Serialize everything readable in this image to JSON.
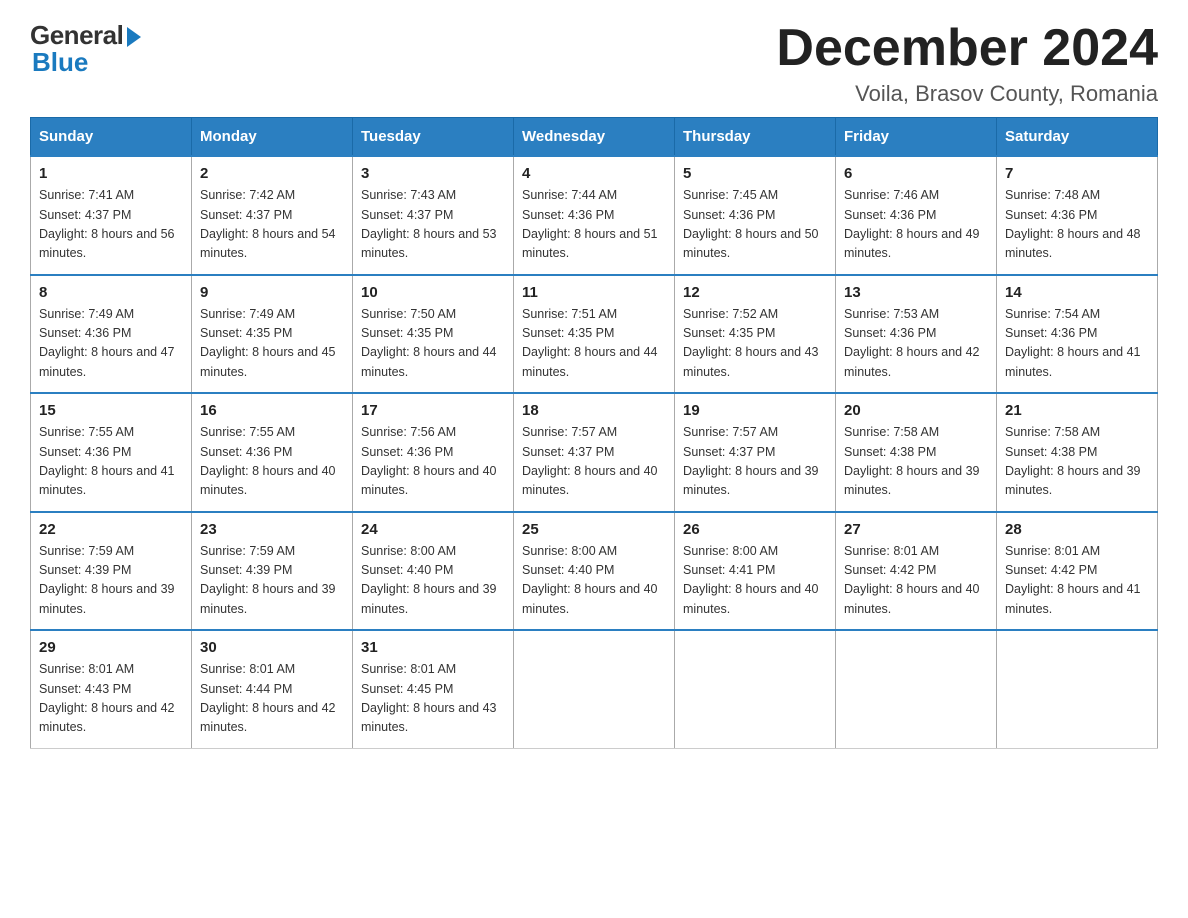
{
  "logo": {
    "general": "General",
    "blue": "Blue"
  },
  "title": "December 2024",
  "location": "Voila, Brasov County, Romania",
  "weekdays": [
    "Sunday",
    "Monday",
    "Tuesday",
    "Wednesday",
    "Thursday",
    "Friday",
    "Saturday"
  ],
  "weeks": [
    [
      {
        "day": "1",
        "sunrise": "7:41 AM",
        "sunset": "4:37 PM",
        "daylight": "8 hours and 56 minutes."
      },
      {
        "day": "2",
        "sunrise": "7:42 AM",
        "sunset": "4:37 PM",
        "daylight": "8 hours and 54 minutes."
      },
      {
        "day": "3",
        "sunrise": "7:43 AM",
        "sunset": "4:37 PM",
        "daylight": "8 hours and 53 minutes."
      },
      {
        "day": "4",
        "sunrise": "7:44 AM",
        "sunset": "4:36 PM",
        "daylight": "8 hours and 51 minutes."
      },
      {
        "day": "5",
        "sunrise": "7:45 AM",
        "sunset": "4:36 PM",
        "daylight": "8 hours and 50 minutes."
      },
      {
        "day": "6",
        "sunrise": "7:46 AM",
        "sunset": "4:36 PM",
        "daylight": "8 hours and 49 minutes."
      },
      {
        "day": "7",
        "sunrise": "7:48 AM",
        "sunset": "4:36 PM",
        "daylight": "8 hours and 48 minutes."
      }
    ],
    [
      {
        "day": "8",
        "sunrise": "7:49 AM",
        "sunset": "4:36 PM",
        "daylight": "8 hours and 47 minutes."
      },
      {
        "day": "9",
        "sunrise": "7:49 AM",
        "sunset": "4:35 PM",
        "daylight": "8 hours and 45 minutes."
      },
      {
        "day": "10",
        "sunrise": "7:50 AM",
        "sunset": "4:35 PM",
        "daylight": "8 hours and 44 minutes."
      },
      {
        "day": "11",
        "sunrise": "7:51 AM",
        "sunset": "4:35 PM",
        "daylight": "8 hours and 44 minutes."
      },
      {
        "day": "12",
        "sunrise": "7:52 AM",
        "sunset": "4:35 PM",
        "daylight": "8 hours and 43 minutes."
      },
      {
        "day": "13",
        "sunrise": "7:53 AM",
        "sunset": "4:36 PM",
        "daylight": "8 hours and 42 minutes."
      },
      {
        "day": "14",
        "sunrise": "7:54 AM",
        "sunset": "4:36 PM",
        "daylight": "8 hours and 41 minutes."
      }
    ],
    [
      {
        "day": "15",
        "sunrise": "7:55 AM",
        "sunset": "4:36 PM",
        "daylight": "8 hours and 41 minutes."
      },
      {
        "day": "16",
        "sunrise": "7:55 AM",
        "sunset": "4:36 PM",
        "daylight": "8 hours and 40 minutes."
      },
      {
        "day": "17",
        "sunrise": "7:56 AM",
        "sunset": "4:36 PM",
        "daylight": "8 hours and 40 minutes."
      },
      {
        "day": "18",
        "sunrise": "7:57 AM",
        "sunset": "4:37 PM",
        "daylight": "8 hours and 40 minutes."
      },
      {
        "day": "19",
        "sunrise": "7:57 AM",
        "sunset": "4:37 PM",
        "daylight": "8 hours and 39 minutes."
      },
      {
        "day": "20",
        "sunrise": "7:58 AM",
        "sunset": "4:38 PM",
        "daylight": "8 hours and 39 minutes."
      },
      {
        "day": "21",
        "sunrise": "7:58 AM",
        "sunset": "4:38 PM",
        "daylight": "8 hours and 39 minutes."
      }
    ],
    [
      {
        "day": "22",
        "sunrise": "7:59 AM",
        "sunset": "4:39 PM",
        "daylight": "8 hours and 39 minutes."
      },
      {
        "day": "23",
        "sunrise": "7:59 AM",
        "sunset": "4:39 PM",
        "daylight": "8 hours and 39 minutes."
      },
      {
        "day": "24",
        "sunrise": "8:00 AM",
        "sunset": "4:40 PM",
        "daylight": "8 hours and 39 minutes."
      },
      {
        "day": "25",
        "sunrise": "8:00 AM",
        "sunset": "4:40 PM",
        "daylight": "8 hours and 40 minutes."
      },
      {
        "day": "26",
        "sunrise": "8:00 AM",
        "sunset": "4:41 PM",
        "daylight": "8 hours and 40 minutes."
      },
      {
        "day": "27",
        "sunrise": "8:01 AM",
        "sunset": "4:42 PM",
        "daylight": "8 hours and 40 minutes."
      },
      {
        "day": "28",
        "sunrise": "8:01 AM",
        "sunset": "4:42 PM",
        "daylight": "8 hours and 41 minutes."
      }
    ],
    [
      {
        "day": "29",
        "sunrise": "8:01 AM",
        "sunset": "4:43 PM",
        "daylight": "8 hours and 42 minutes."
      },
      {
        "day": "30",
        "sunrise": "8:01 AM",
        "sunset": "4:44 PM",
        "daylight": "8 hours and 42 minutes."
      },
      {
        "day": "31",
        "sunrise": "8:01 AM",
        "sunset": "4:45 PM",
        "daylight": "8 hours and 43 minutes."
      },
      null,
      null,
      null,
      null
    ]
  ]
}
